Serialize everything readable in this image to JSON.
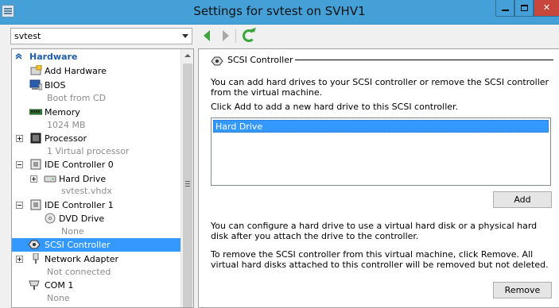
{
  "window": {
    "title": "Settings for svtest on SVHV1",
    "minimize_icon": "minimize-icon",
    "maximize_icon": "maximize-icon",
    "close_icon": "close-icon",
    "accent_color": "#45a0d8",
    "close_color": "#c7473d"
  },
  "toolbar": {
    "vm_select_value": "svtest",
    "back_icon": "back-arrow-icon",
    "forward_icon": "forward-arrow-icon",
    "refresh_icon": "refresh-icon"
  },
  "tree": {
    "hardware_header": "Hardware",
    "items": [
      {
        "label": "Add Hardware",
        "icon": "add-hardware-icon"
      },
      {
        "label": "BIOS",
        "sub": "Boot from CD",
        "icon": "bios-icon"
      },
      {
        "label": "Memory",
        "sub": "1024 MB",
        "icon": "memory-icon"
      },
      {
        "label": "Processor",
        "sub": "1 Virtual processor",
        "icon": "processor-icon"
      },
      {
        "label": "IDE Controller 0",
        "icon": "ide-controller-icon"
      },
      {
        "label": "Hard Drive",
        "sub": "svtest.vhdx",
        "icon": "hard-drive-icon"
      },
      {
        "label": "IDE Controller 1",
        "icon": "ide-controller-icon"
      },
      {
        "label": "DVD Drive",
        "sub": "None",
        "icon": "dvd-drive-icon"
      },
      {
        "label": "SCSI Controller",
        "icon": "scsi-controller-icon",
        "selected": true
      },
      {
        "label": "Network Adapter",
        "sub": "Not connected",
        "icon": "network-adapter-icon"
      },
      {
        "label": "COM 1",
        "sub": "None",
        "icon": "com-port-icon"
      }
    ],
    "selection_color": "#3399ff"
  },
  "panel": {
    "section_title": "SCSI Controller",
    "intro": "You can add hard drives to your SCSI controller or remove the SCSI controller from the virtual machine.",
    "click_add": "Click Add to add a new hard drive to this SCSI controller.",
    "list_items": [
      "Hard Drive"
    ],
    "add_button": "Add",
    "configure_text": "You can configure a hard drive to use a virtual hard disk or a physical hard disk after you attach the drive to the controller.",
    "remove_text": "To remove the SCSI controller from this virtual machine, click Remove. All virtual hard disks attached to this controller will be removed but not deleted.",
    "remove_button": "Remove"
  }
}
